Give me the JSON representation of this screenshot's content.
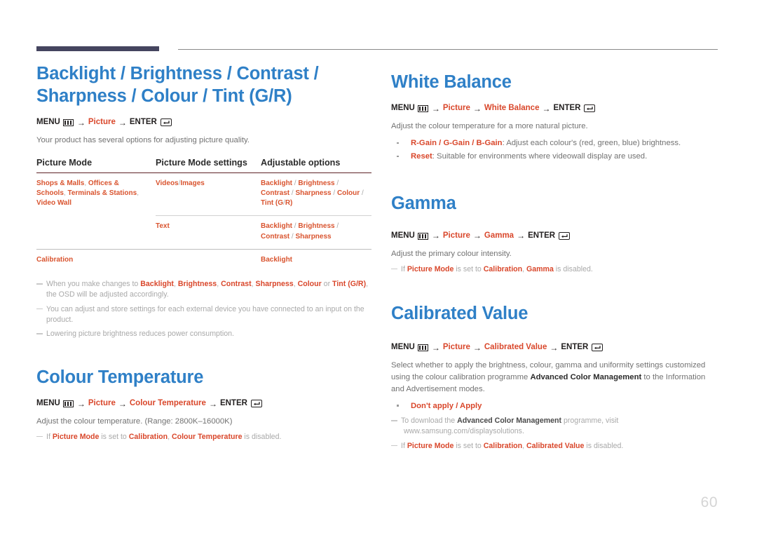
{
  "page": {
    "number": "60"
  },
  "icons": {
    "menu": "menu-icon",
    "enter": "enter-icon",
    "arrow": "→"
  },
  "left_column": {
    "section1": {
      "title": "Backlight / Brightness / Contrast / Sharpness / Colour / Tint (G/R)",
      "menupath": {
        "menu_label": "MENU",
        "step1": "Picture",
        "enter_label": "ENTER"
      },
      "intro": "Your product has several options for adjusting picture quality.",
      "table": {
        "headers": [
          "Picture Mode",
          "Picture Mode settings",
          "Adjustable options"
        ],
        "rows": [
          {
            "mode": "Shops & Malls, Offices & Schools, Terminals & Stations, Video Wall",
            "settings": "Videos/Images",
            "options": "Backlight /  Brightness / Contrast / Sharpness / Colour / Tint (G/R)"
          },
          {
            "mode": "",
            "settings": "Text",
            "options": "Backlight / Brightness / Contrast / Sharpness"
          },
          {
            "mode": "Calibration",
            "settings": "",
            "options": "Backlight"
          }
        ]
      },
      "notes": [
        "When you make changes to Backlight, Brightness, Contrast, Sharpness, Colour or Tint (G/R), the OSD will be adjusted accordingly.",
        "You can adjust and store settings for each external device you have connected to an input on the product.",
        "Lowering picture brightness reduces power consumption."
      ]
    },
    "section2": {
      "title": "Colour Temperature",
      "menupath": {
        "menu_label": "MENU",
        "step1": "Picture",
        "step2": "Colour Temperature",
        "enter_label": "ENTER"
      },
      "intro": "Adjust the colour temperature. (Range: 2800K–16000K)",
      "note": "If Picture Mode is set to Calibration, Colour Temperature is disabled."
    }
  },
  "right_column": {
    "section1": {
      "title": "White Balance",
      "menupath": {
        "menu_label": "MENU",
        "step1": "Picture",
        "step2": "White Balance",
        "enter_label": "ENTER"
      },
      "intro": "Adjust the colour temperature for a more natural picture.",
      "bullets": [
        {
          "hl": "R-Gain / G-Gain / B-Gain",
          "rest": ": Adjust each colour's (red, green, blue) brightness."
        },
        {
          "hl": "Reset",
          "rest": ": Suitable for environments where videowall display are used."
        }
      ]
    },
    "section2": {
      "title": "Gamma",
      "menupath": {
        "menu_label": "MENU",
        "step1": "Picture",
        "step2": "Gamma",
        "enter_label": "ENTER"
      },
      "intro": "Adjust the primary colour intensity.",
      "note": "If Picture Mode is set to Calibration, Gamma is disabled."
    },
    "section3": {
      "title": "Calibrated Value",
      "menupath": {
        "menu_label": "MENU",
        "step1": "Picture",
        "step2": "Calibrated Value",
        "enter_label": "ENTER"
      },
      "intro_part1": "Select whether to apply the brightness, colour, gamma and uniformity settings customized using the colour calibration programme ",
      "intro_bold": "Advanced Color Management",
      "intro_part2": " to the Information and Advertisement modes.",
      "bullets": [
        {
          "hl": "Don't apply / Apply",
          "rest": ""
        }
      ],
      "note1_pre": "To download the ",
      "note1_bold": "Advanced Color Management",
      "note1_post": " programme, visit",
      "note1_url": "www.samsung.com/displaysolutions.",
      "note2": "If Picture Mode is set to Calibration, Calibrated Value is disabled."
    }
  },
  "colors": {
    "heading_blue": "#2f80c7",
    "highlight_red": "#d9472b",
    "table_orange": "#d9542f",
    "rule_navy": "#45455f",
    "body_gray": "#727272"
  }
}
